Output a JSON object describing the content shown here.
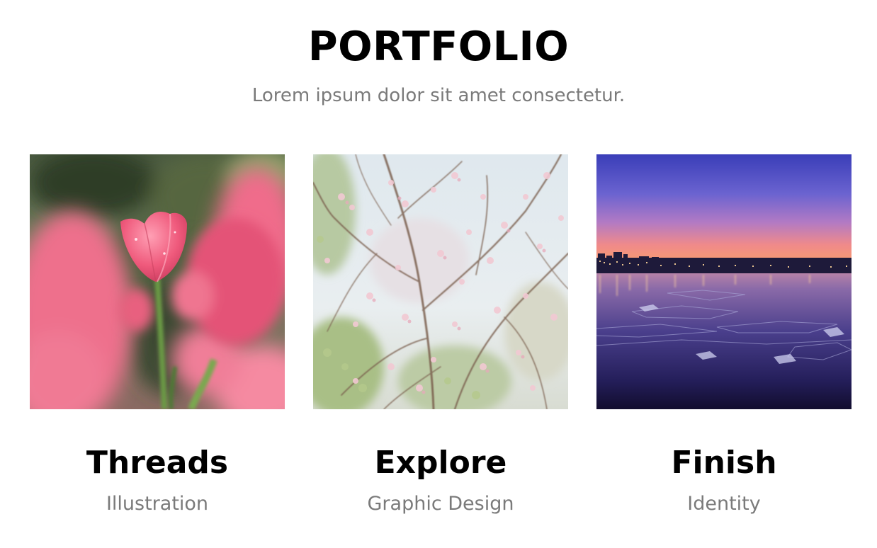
{
  "header": {
    "title": "PORTFOLIO",
    "subtitle": "Lorem ipsum dolor sit amet consectetur."
  },
  "portfolio": {
    "items": [
      {
        "title": "Threads",
        "category": "Illustration",
        "image": "pink-tulips-photo"
      },
      {
        "title": "Explore",
        "category": "Graphic Design",
        "image": "cherry-blossom-branches-photo"
      },
      {
        "title": "Finish",
        "category": "Identity",
        "image": "city-skyline-dusk-river-photo"
      }
    ]
  },
  "colors": {
    "title": "#000000",
    "muted_text": "#7a7a7a",
    "background": "#ffffff"
  }
}
